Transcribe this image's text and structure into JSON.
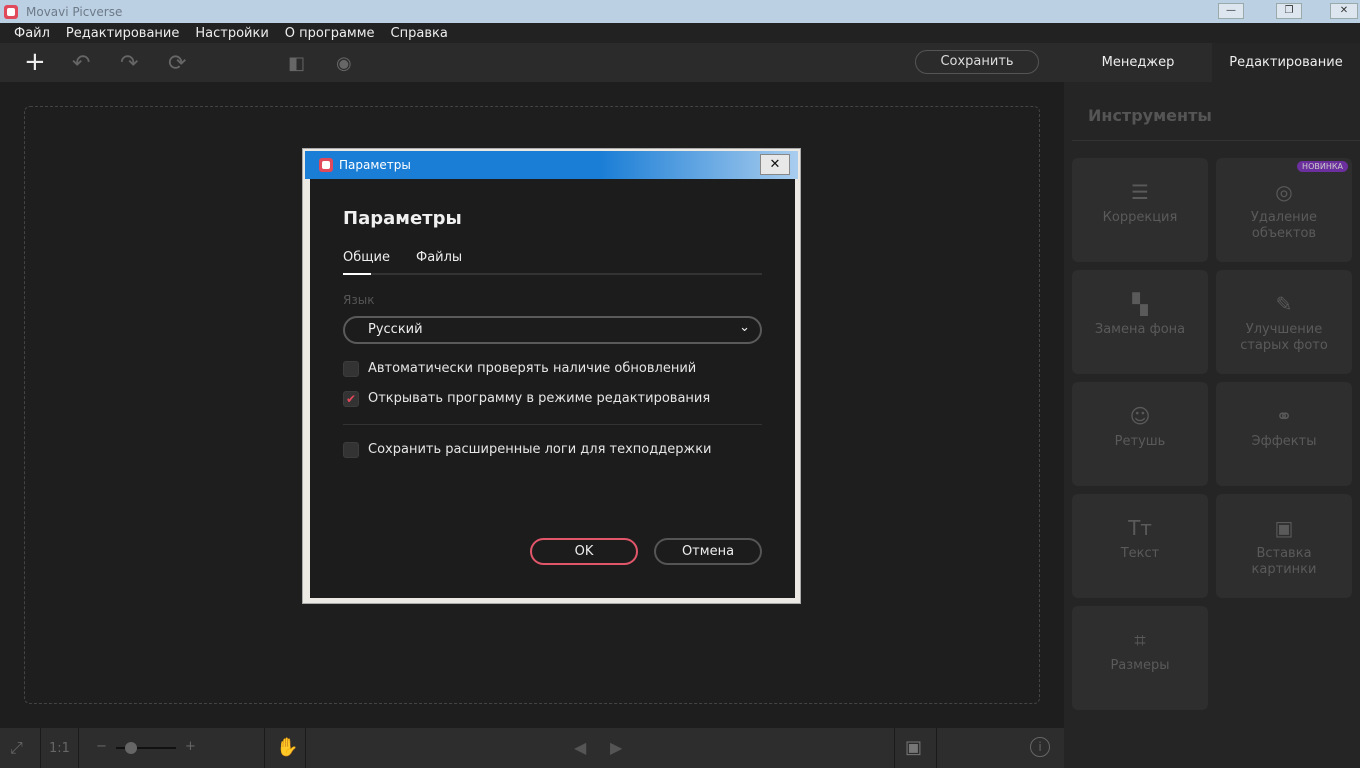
{
  "window": {
    "title": "Movavi Picverse",
    "minimize": "—",
    "maximize": "❐",
    "close": "✕"
  },
  "menu": [
    "Файл",
    "Редактирование",
    "Настройки",
    "О программе",
    "Справка"
  ],
  "toolbar": {
    "save": "Сохранить",
    "tabs": [
      "Менеджер",
      "Редактирование"
    ]
  },
  "panel": {
    "title": "Инструменты",
    "badge": "НОВИНКА",
    "tools": [
      {
        "label": "Коррекция",
        "icon": "sliders-icon",
        "glyph": "☰"
      },
      {
        "label": "Удаление объектов",
        "icon": "cursor-target-icon",
        "glyph": "◎"
      },
      {
        "label": "Замена фона",
        "icon": "background-icon",
        "glyph": "▚"
      },
      {
        "label": "Улучшение старых фото",
        "icon": "magic-wand-icon",
        "glyph": "✎"
      },
      {
        "label": "Ретушь",
        "icon": "face-icon",
        "glyph": "☺"
      },
      {
        "label": "Эффекты",
        "icon": "circles-icon",
        "glyph": "⚭"
      },
      {
        "label": "Текст",
        "icon": "text-icon",
        "glyph": "Tт"
      },
      {
        "label": "Вставка картинки",
        "icon": "image-icon",
        "glyph": "▣"
      },
      {
        "label": "Размеры",
        "icon": "crop-icon",
        "glyph": "⌗"
      }
    ]
  },
  "bottom": {
    "ratio": "1:1",
    "minus": "−",
    "plus": "+",
    "zoom_fraction": 0.25
  },
  "dialog": {
    "window_title": "Параметры",
    "heading": "Параметры",
    "tabs": [
      "Общие",
      "Файлы"
    ],
    "language_label": "Язык",
    "language_value": "Русский",
    "options": [
      {
        "label": "Автоматически проверять наличие обновлений",
        "checked": false
      },
      {
        "label": "Открывать программу в режиме редактирования",
        "checked": true
      },
      {
        "label": "Сохранить расширенные логи для техподдержки",
        "checked": false
      }
    ],
    "ok": "OK",
    "cancel": "Отмена"
  }
}
